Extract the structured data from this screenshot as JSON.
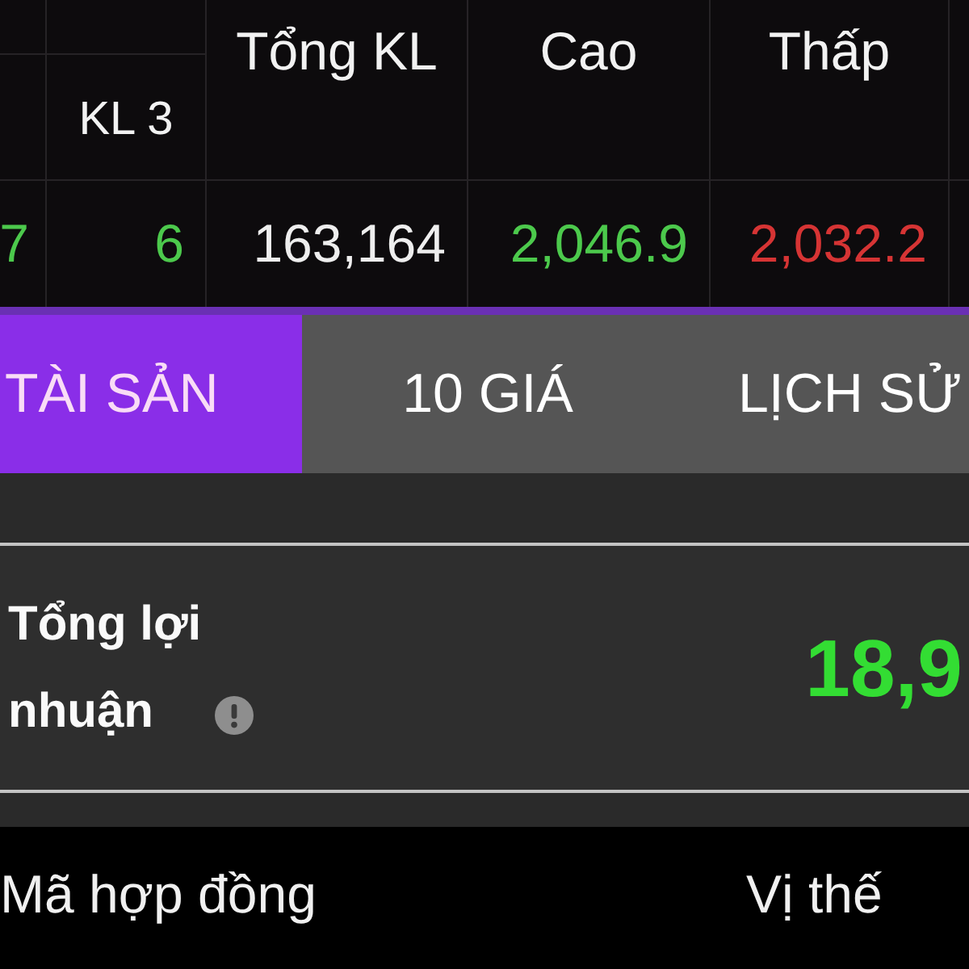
{
  "table": {
    "columns": [
      {
        "kind": "sub"
      },
      {
        "kind": "sub",
        "label": "KL 3"
      },
      {
        "kind": "main",
        "label": "Tổng KL"
      },
      {
        "kind": "main",
        "label": "Cao"
      },
      {
        "kind": "main",
        "label": "Thấp"
      }
    ],
    "rows": [
      {
        "cells": [
          {
            "text": "7",
            "color": "#4cc94c"
          },
          {
            "text": "6",
            "color": "#4cc94c"
          },
          {
            "text": "163,164",
            "color": "#eeeeee"
          },
          {
            "text": "2,046.9",
            "color": "#4cc94c"
          },
          {
            "text": "2,032.2",
            "color": "#d63434"
          }
        ]
      }
    ]
  },
  "tabs": [
    {
      "label": "TÀI SẢN",
      "selected": true
    },
    {
      "label": "10 GIÁ",
      "selected": false
    },
    {
      "label": "LỊCH SỬ",
      "selected": false
    }
  ],
  "summary": {
    "label": "Tổng lợi nhuận",
    "value": "18,9"
  },
  "positions": {
    "columns": [
      "Mã hợp đồng",
      "Vị thế"
    ]
  }
}
